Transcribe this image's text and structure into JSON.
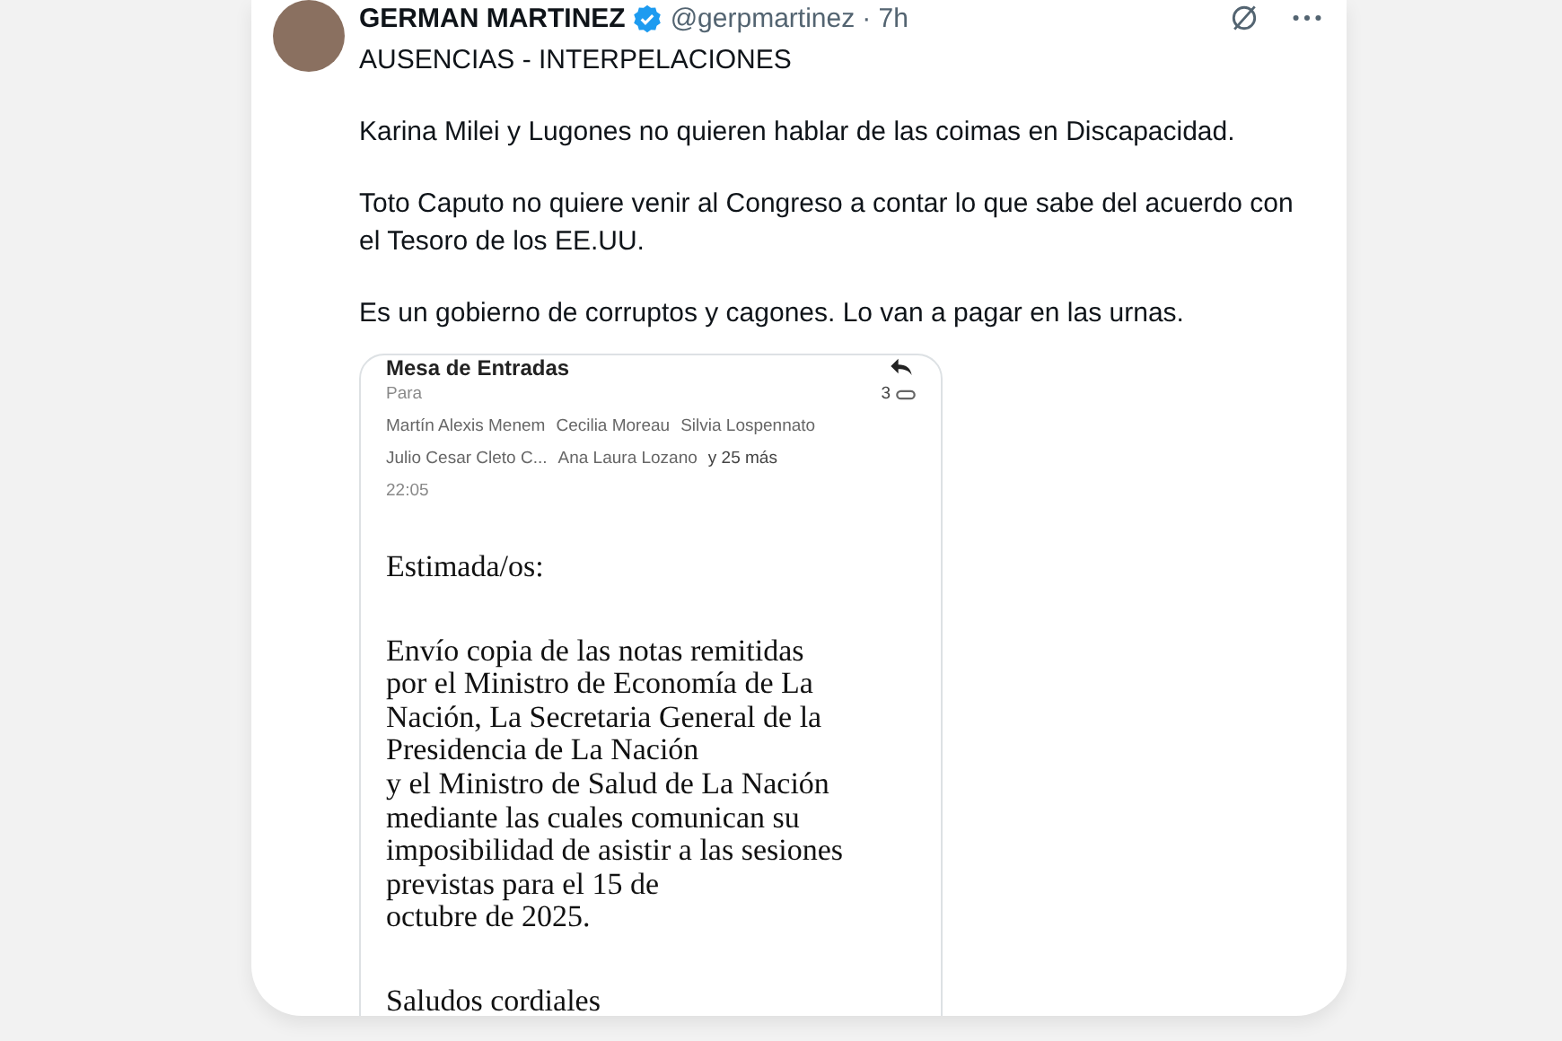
{
  "post": {
    "author": {
      "name": "GERMAN MARTINEZ",
      "verified": true,
      "handle": "@gerpmartinez",
      "time": "· 7h"
    },
    "paragraphs": [
      "AUSENCIAS - INTERPELACIONES",
      "Karina Milei y Lugones no quieren hablar de las coimas en Discapacidad.",
      "Toto Caputo no quiere venir al Congreso a contar lo que sabe del acuerdo con el Tesoro de los EE.UU.",
      "Es un gobierno de corruptos y cagones. Lo van a pagar en las urnas."
    ],
    "email": {
      "subject": "Mesa de Entradas",
      "to_label": "Para",
      "attachments": "3",
      "recipients": [
        [
          "Martín Alexis Menem",
          "Cecilia Moreau",
          "Silvia Lospennato"
        ],
        [
          "Julio Cesar Cleto C...",
          "Ana Laura Lozano"
        ]
      ],
      "more": "y 25 más",
      "time": "22:05",
      "body": [
        "Estimada/os:",
        "Envío copia de las notas remitidas\npor el Ministro de Economía de La\nNación, La Secretaria General de la\nPresidencia de La Nación\ny el Ministro de Salud de La Nación\nmediante las cuales comunican su\nimposibilidad de asistir a las sesiones\nprevistas para el 15 de\noctubre de 2025.",
        "Saludos cordiales"
      ]
    }
  }
}
